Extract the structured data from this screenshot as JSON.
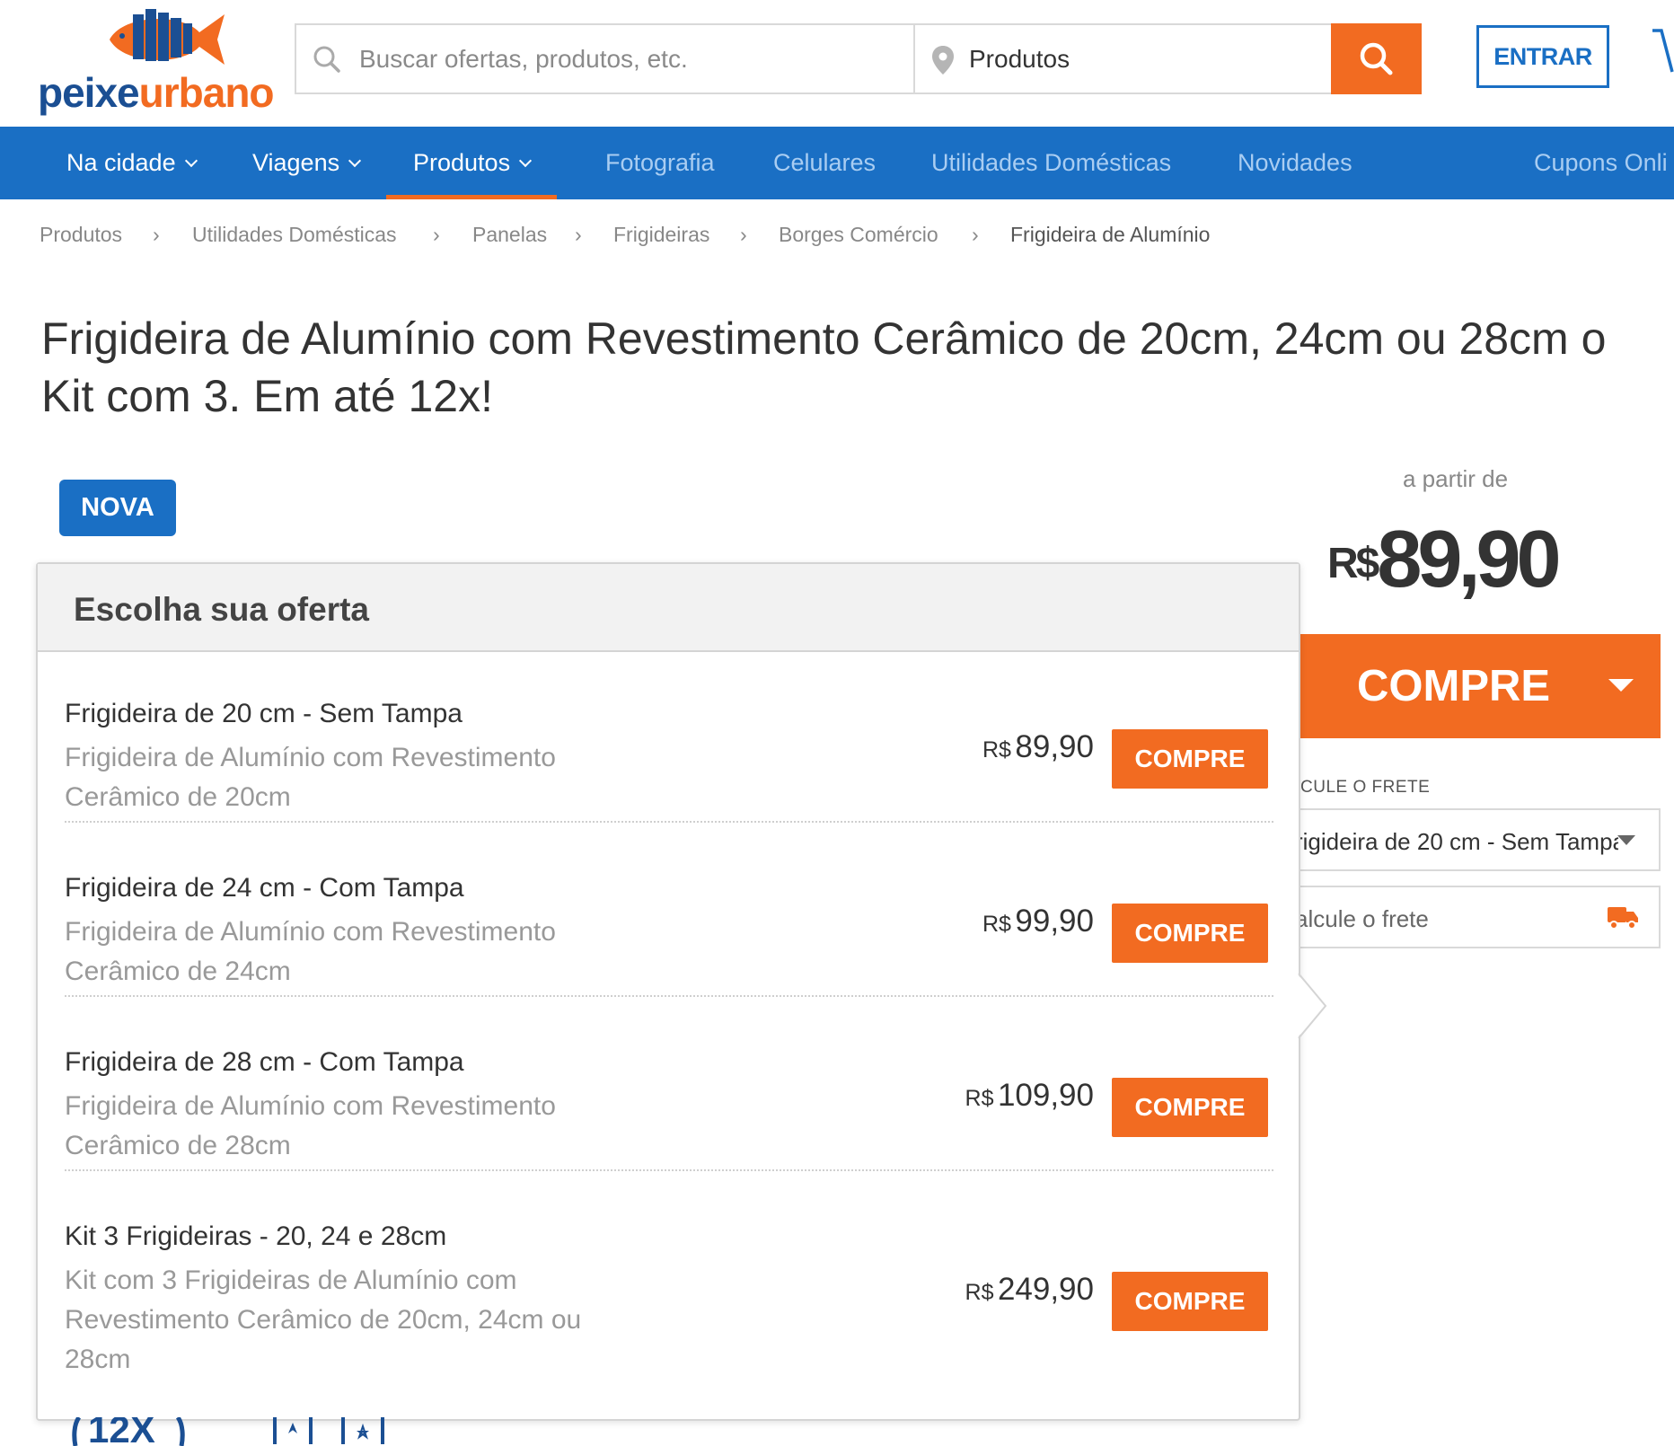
{
  "header": {
    "logo": {
      "part1": "peixe",
      "part2": "urbano"
    },
    "search_placeholder": "Buscar ofertas, produtos, etc.",
    "location_value": "Produtos",
    "login_label": "ENTRAR"
  },
  "nav": {
    "items": [
      {
        "label": "Na cidade",
        "dropdown": true
      },
      {
        "label": "Viagens",
        "dropdown": true
      },
      {
        "label": "Produtos",
        "dropdown": true,
        "active": true
      },
      {
        "label": "Fotografia"
      },
      {
        "label": "Celulares"
      },
      {
        "label": "Utilidades Domésticas"
      },
      {
        "label": "Novidades"
      },
      {
        "label": "Cupons Onli"
      }
    ]
  },
  "breadcrumb": [
    "Produtos",
    "Utilidades Domésticas",
    "Panelas",
    "Frigideiras",
    "Borges Comércio",
    "Frigideira de Alumínio"
  ],
  "breadcrumb_sep": "›",
  "title_line1": "Frigideira de Alumínio com Revestimento Cerâmico de 20cm, 24cm ou 28cm o",
  "title_line2": "Kit com 3. Em até 12x!",
  "badge": "NOVA",
  "price_panel": {
    "from_label": "a partir de",
    "currency": "R$",
    "price": "89,90",
    "buy_label": "COMPRE",
    "shipping_label": "CULE O FRETE",
    "shipping_select_value": "rigideira de 20 cm - Sem Tampa",
    "shipping_input_placeholder": "alcule o frete"
  },
  "offers": {
    "heading": "Escolha sua oferta",
    "items": [
      {
        "name": "Frigideira de 20 cm - Sem Tampa",
        "desc": "Frigideira de Alumínio com Revestimento Cerâmico de 20cm",
        "currency": "R$",
        "price": "89,90",
        "button": "COMPRE"
      },
      {
        "name": "Frigideira de 24 cm - Com Tampa",
        "desc": "Frigideira de Alumínio com Revestimento Cerâmico de 24cm",
        "currency": "R$",
        "price": "99,90",
        "button": "COMPRE"
      },
      {
        "name": "Frigideira de 28 cm - Com Tampa",
        "desc": "Frigideira de Alumínio com Revestimento Cerâmico de 28cm",
        "currency": "R$",
        "price": "109,90",
        "button": "COMPRE"
      },
      {
        "name": "Kit 3 Frigideiras - 20, 24 e 28cm",
        "desc": "Kit com 3 Frigideiras de Alumínio com Revestimento Cerâmico de 20cm, 24cm ou 28cm",
        "currency": "R$",
        "price": "249,90",
        "button": "COMPRE"
      }
    ]
  },
  "colors": {
    "brand_blue": "#1a6fc4",
    "brand_orange": "#f26b21",
    "logo_blue": "#1b4f93"
  },
  "icons": [
    "search-icon",
    "location-pin-icon",
    "cart-icon",
    "truck-icon",
    "caret-down-icon",
    "fish-logo-icon"
  ]
}
